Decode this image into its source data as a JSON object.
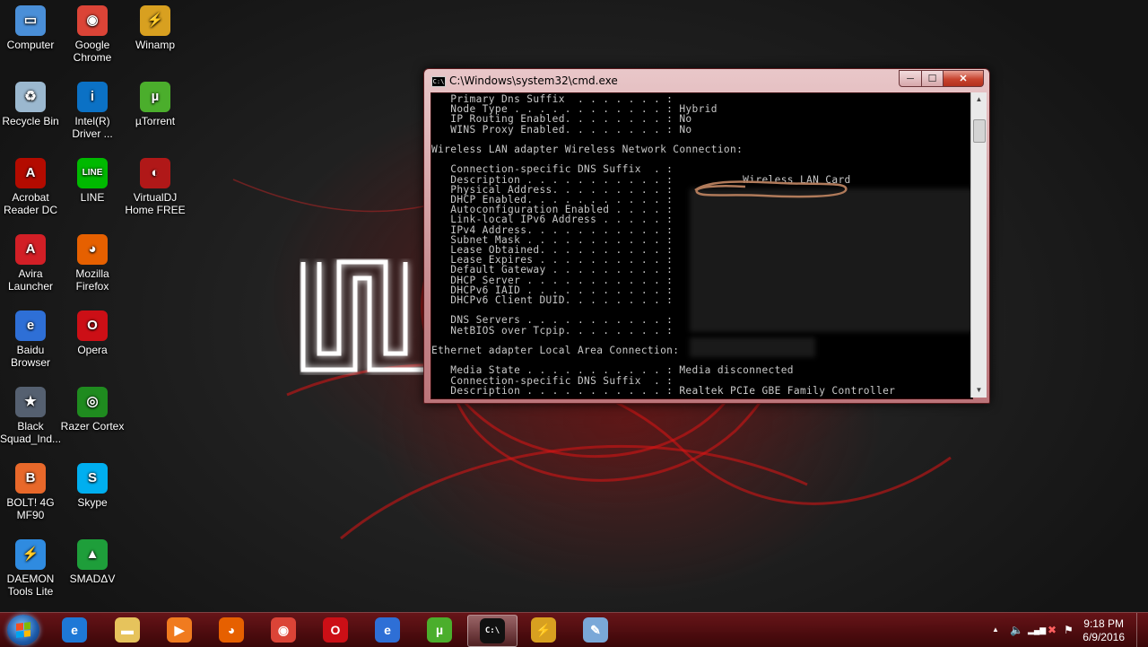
{
  "desktop": {
    "icons_col1": [
      {
        "label": "Computer",
        "icon": "computer-icon",
        "color": "#4a8fd8",
        "glyph": "▭"
      },
      {
        "label": "Recycle Bin",
        "icon": "recycle-bin-icon",
        "color": "#9bb8cf",
        "glyph": "♻"
      },
      {
        "label": "Acrobat Reader DC",
        "icon": "acrobat-icon",
        "color": "#b30b00",
        "glyph": "A"
      },
      {
        "label": "Avira Launcher",
        "icon": "avira-icon",
        "color": "#d21f26",
        "glyph": "A"
      },
      {
        "label": "Baidu Browser",
        "icon": "baidu-browser-icon",
        "color": "#2e6fd6",
        "glyph": "e"
      },
      {
        "label": "Black Squad_Ind...",
        "icon": "black-squad-icon",
        "color": "#556070",
        "glyph": "★"
      },
      {
        "label": "BOLT! 4G MF90",
        "icon": "bolt-modem-icon",
        "color": "#e8682a",
        "glyph": "B"
      },
      {
        "label": "DAEMON Tools Lite",
        "icon": "daemon-tools-icon",
        "color": "#2f8be0",
        "glyph": "⚡"
      }
    ],
    "icons_col2": [
      {
        "label": "Google Chrome",
        "icon": "chrome-icon",
        "color": "#db4437",
        "glyph": "◉"
      },
      {
        "label": "Intel(R) Driver ...",
        "icon": "intel-driver-icon",
        "color": "#0b71c5",
        "glyph": "i"
      },
      {
        "label": "LINE",
        "icon": "line-icon",
        "color": "#00b900",
        "glyph": "LINE"
      },
      {
        "label": "Mozilla Firefox",
        "icon": "firefox-icon",
        "color": "#e66000",
        "glyph": "◕"
      },
      {
        "label": "Opera",
        "icon": "opera-icon",
        "color": "#cc0f16",
        "glyph": "O"
      },
      {
        "label": "Razer Cortex",
        "icon": "razer-cortex-icon",
        "color": "#1f8b1f",
        "glyph": "◎"
      },
      {
        "label": "Skype",
        "icon": "skype-icon",
        "color": "#00aff0",
        "glyph": "S"
      },
      {
        "label": "SMADΔV",
        "icon": "smadav-icon",
        "color": "#1e9e3a",
        "glyph": "▲"
      }
    ],
    "icons_col3": [
      {
        "label": "Winamp",
        "icon": "winamp-icon",
        "color": "#d8a020",
        "glyph": "⚡"
      },
      {
        "label": "µTorrent",
        "icon": "utorrent-icon",
        "color": "#4bae2c",
        "glyph": "µ"
      },
      {
        "label": "VirtualDJ Home FREE",
        "icon": "virtualdj-icon",
        "color": "#b01818",
        "glyph": "◐"
      }
    ]
  },
  "cmd_window": {
    "title": "C:\\Windows\\system32\\cmd.exe",
    "title_icon_text": "C:\\",
    "buttons": {
      "minimize": "─",
      "maximize": "☐",
      "close": "✕"
    },
    "lines": [
      "   Primary Dns Suffix  . . . . . . . : ",
      "   Node Type . . . . . . . . . . . . : Hybrid",
      "   IP Routing Enabled. . . . . . . . : No",
      "   WINS Proxy Enabled. . . . . . . . : No",
      "",
      "Wireless LAN adapter Wireless Network Connection:",
      "",
      "   Connection-specific DNS Suffix  . :",
      "   Description . . . . . . . . . . . :           Wireless LAN Card",
      "   Physical Address. . . . . . . . . :",
      "   DHCP Enabled. . . . . . . . . . . :",
      "   Autoconfiguration Enabled . . . . :",
      "   Link-local IPv6 Address . . . . . :",
      "   IPv4 Address. . . . . . . . . . . :",
      "   Subnet Mask . . . . . . . . . . . :",
      "   Lease Obtained. . . . . . . . . . :",
      "   Lease Expires . . . . . . . . . . :",
      "   Default Gateway . . . . . . . . . :",
      "   DHCP Server . . . . . . . . . . . :",
      "   DHCPv6 IAID . . . . . . . . . . . :",
      "   DHCPv6 Client DUID. . . . . . . . :",
      "",
      "   DNS Servers . . . . . . . . . . . :",
      "   NetBIOS over Tcpip. . . . . . . . :",
      "",
      "Ethernet adapter Local Area Connection:",
      "",
      "   Media State . . . . . . . . . . . : Media disconnected",
      "   Connection-specific DNS Suffix  . :",
      "   Description . . . . . . . . . . . : Realtek PCIe GBE Family Controller"
    ]
  },
  "taskbar": {
    "pinned": [
      {
        "name": "taskbar-internet-explorer",
        "icon": "internet-explorer-icon",
        "color": "#1e78d6",
        "glyph": "e"
      },
      {
        "name": "taskbar-file-explorer",
        "icon": "folder-icon",
        "color": "#e6c35c",
        "glyph": "▬"
      },
      {
        "name": "taskbar-media-player",
        "icon": "media-player-icon",
        "color": "#f07b1f",
        "glyph": "▶"
      },
      {
        "name": "taskbar-firefox",
        "icon": "firefox-icon",
        "color": "#e66000",
        "glyph": "◕"
      },
      {
        "name": "taskbar-chrome",
        "icon": "chrome-icon",
        "color": "#db4437",
        "glyph": "◉"
      },
      {
        "name": "taskbar-opera",
        "icon": "opera-icon",
        "color": "#cc0f16",
        "glyph": "O"
      },
      {
        "name": "taskbar-baidu-browser",
        "icon": "baidu-browser-icon",
        "color": "#2e6fd6",
        "glyph": "e"
      },
      {
        "name": "taskbar-utorrent",
        "icon": "utorrent-icon",
        "color": "#4bae2c",
        "glyph": "µ"
      },
      {
        "name": "taskbar-cmd",
        "icon": "cmd-icon",
        "color": "#111111",
        "glyph": "C:\\"
      },
      {
        "name": "taskbar-winamp",
        "icon": "winamp-icon",
        "color": "#d8a020",
        "glyph": "⚡"
      },
      {
        "name": "taskbar-paint",
        "icon": "paint-icon",
        "color": "#7aa8d8",
        "glyph": "✎"
      }
    ],
    "active_index": 8,
    "tray": {
      "up_arrow": "▲",
      "volume": "🔈",
      "signal": "▂▄▆",
      "network": "✖",
      "flag": "⚑",
      "time": "9:18 PM",
      "date": "6/9/2016"
    }
  }
}
